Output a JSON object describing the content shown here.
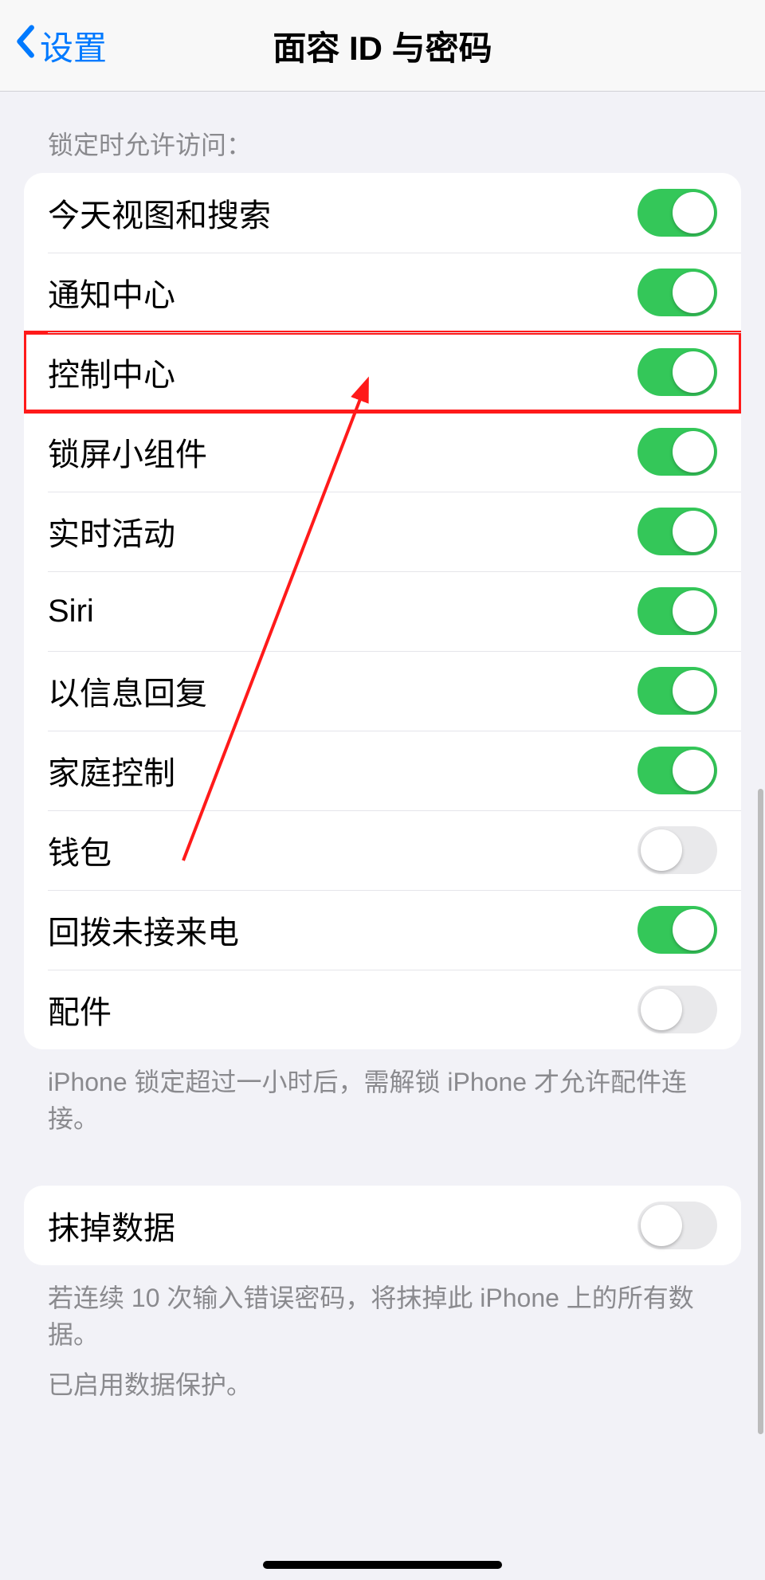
{
  "nav": {
    "back_label": "设置",
    "title": "面容 ID 与密码"
  },
  "section_header": "锁定时允许访问：",
  "items": [
    {
      "label": "今天视图和搜索",
      "on": true,
      "highlight": false
    },
    {
      "label": "通知中心",
      "on": true,
      "highlight": false
    },
    {
      "label": "控制中心",
      "on": true,
      "highlight": true
    },
    {
      "label": "锁屏小组件",
      "on": true,
      "highlight": false
    },
    {
      "label": "实时活动",
      "on": true,
      "highlight": false
    },
    {
      "label": "Siri",
      "on": true,
      "highlight": false
    },
    {
      "label": "以信息回复",
      "on": true,
      "highlight": false
    },
    {
      "label": "家庭控制",
      "on": true,
      "highlight": false
    },
    {
      "label": "钱包",
      "on": false,
      "highlight": false
    },
    {
      "label": "回拨未接来电",
      "on": true,
      "highlight": false
    },
    {
      "label": "配件",
      "on": false,
      "highlight": false
    }
  ],
  "section_footer": "iPhone 锁定超过一小时后，需解锁 iPhone 才允许配件连接。",
  "erase": {
    "label": "抹掉数据",
    "on": false,
    "footer1": "若连续 10 次输入错误密码，将抹掉此 iPhone 上的所有数据。",
    "footer2": "已启用数据保护。"
  },
  "annotation": {
    "highlight_color": "#ff1a1a"
  }
}
